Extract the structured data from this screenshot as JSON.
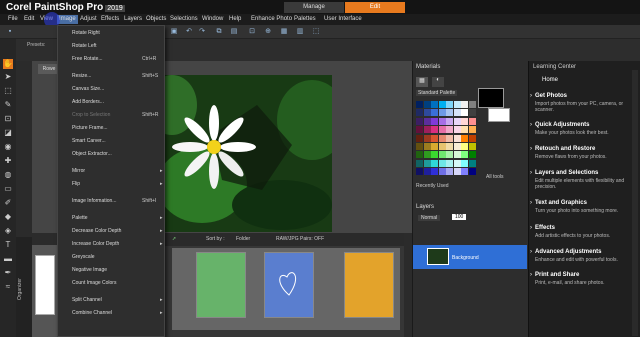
{
  "app": {
    "logo_text": "Corel PaintShop Pro",
    "version": "2019",
    "tabs": [
      "Manage",
      "Edit"
    ]
  },
  "menubar": [
    "File",
    "Edit",
    "View",
    "Image",
    "Adjust",
    "Effects",
    "Layers",
    "Objects",
    "Selections",
    "Window",
    "Help",
    "Enhance Photo",
    "Palettes",
    "User Interface"
  ],
  "options": {
    "presets_label": "Presets:",
    "doc_tab": "Rowe"
  },
  "image_menu": {
    "items": [
      {
        "label": "Rotate Right",
        "shortcut": "",
        "arrow": ""
      },
      {
        "label": "Rotate Left",
        "shortcut": "",
        "arrow": ""
      },
      {
        "label": "Free Rotate...",
        "shortcut": "Ctrl+R",
        "arrow": ""
      },
      {
        "label": "Resize...",
        "shortcut": "Shift+S",
        "arrow": ""
      },
      {
        "label": "Canvas Size...",
        "shortcut": "",
        "arrow": ""
      },
      {
        "label": "Add Borders...",
        "shortcut": "",
        "arrow": ""
      },
      {
        "label": "Crop to Selection",
        "shortcut": "Shift+R",
        "arrow": "",
        "disabled": true
      },
      {
        "label": "Picture Frame...",
        "shortcut": "",
        "arrow": ""
      },
      {
        "label": "Smart Carver...",
        "shortcut": "",
        "arrow": ""
      },
      {
        "label": "Object Extractor...",
        "shortcut": "",
        "arrow": ""
      },
      {
        "label": "Mirror",
        "shortcut": "",
        "arrow": "▸"
      },
      {
        "label": "Flip",
        "shortcut": "",
        "arrow": "▸"
      },
      {
        "label": "Image Information...",
        "shortcut": "Shift+I",
        "arrow": ""
      },
      {
        "label": "Palette",
        "shortcut": "",
        "arrow": "▸"
      },
      {
        "label": "Decrease Color Depth",
        "shortcut": "",
        "arrow": "▸"
      },
      {
        "label": "Increase Color Depth",
        "shortcut": "",
        "arrow": "▸"
      },
      {
        "label": "Greyscale",
        "shortcut": "",
        "arrow": ""
      },
      {
        "label": "Negative Image",
        "shortcut": "",
        "arrow": ""
      },
      {
        "label": "Count Image Colors",
        "shortcut": "",
        "arrow": ""
      },
      {
        "label": "Split Channel",
        "shortcut": "",
        "arrow": "▸"
      },
      {
        "label": "Combine Channel",
        "shortcut": "",
        "arrow": "▸"
      }
    ]
  },
  "organizer": {
    "label": "Organizer",
    "sort_by_label": "Sort by :",
    "sort_value": "Folder",
    "raw_pairs": "RAW/JPG Pairs: OFF"
  },
  "materials": {
    "title": "Materials",
    "palette_select": "Standard Palette",
    "recently_used": "Recently Used",
    "all_tools": "All tools"
  },
  "layers": {
    "title": "Layers",
    "blend_mode": "Normal",
    "opacity": "100",
    "layer_name": "Background"
  },
  "learning_center": {
    "title": "Learning Center",
    "home": "Home",
    "sections": [
      {
        "title": "Get Photos",
        "desc": "Import photos from your PC, camera, or scanner."
      },
      {
        "title": "Quick Adjustments",
        "desc": "Make your photos look their best."
      },
      {
        "title": "Retouch and Restore",
        "desc": "Remove flaws from your photos."
      },
      {
        "title": "Layers and Selections",
        "desc": "Edit multiple elements with flexibility and precision."
      },
      {
        "title": "Text and Graphics",
        "desc": "Turn your photo into something more."
      },
      {
        "title": "Effects",
        "desc": "Add artistic effects to your photos."
      },
      {
        "title": "Advanced Adjustments",
        "desc": "Enhance and edit with powerful tools."
      },
      {
        "title": "Print and Share",
        "desc": "Print, e-mail, and share photos."
      }
    ]
  },
  "colors": {
    "accent": "#e87a1e",
    "selection": "#2f6fd6"
  }
}
